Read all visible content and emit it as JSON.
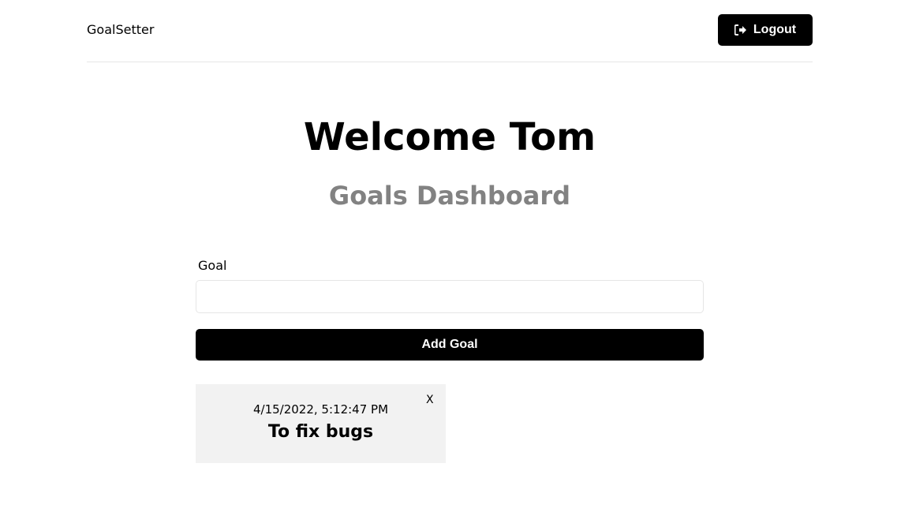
{
  "header": {
    "brand": "GoalSetter",
    "logout_label": "Logout"
  },
  "main": {
    "welcome": "Welcome Tom",
    "subtitle": "Goals Dashboard"
  },
  "form": {
    "goal_label": "Goal",
    "goal_value": "",
    "add_label": "Add Goal"
  },
  "goals": [
    {
      "date": "4/15/2022, 5:12:47 PM",
      "text": "To fix bugs",
      "close_label": "X"
    }
  ],
  "icons": {
    "logout": "sign-out-icon"
  },
  "colors": {
    "primary": "#000000",
    "subtitle": "#828282",
    "card_bg": "#f2f2f2",
    "border": "#e6e6e6"
  }
}
